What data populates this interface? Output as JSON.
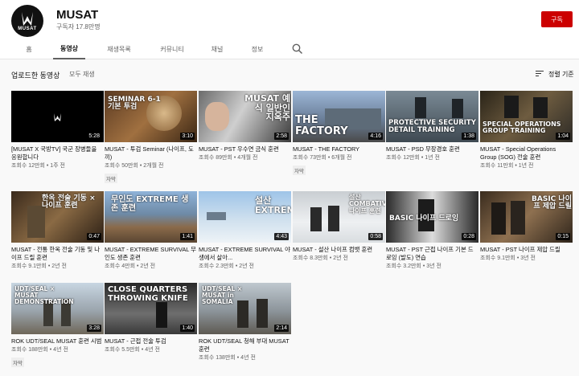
{
  "channel": {
    "name": "MUSAT",
    "subscribers": "구독자 17.8만명",
    "avatar_text": "MUSAT",
    "subscribe_label": "구독"
  },
  "tabs": [
    {
      "label": "홈",
      "active": false
    },
    {
      "label": "동영상",
      "active": true
    },
    {
      "label": "재생목록",
      "active": false
    },
    {
      "label": "커뮤니티",
      "active": false
    },
    {
      "label": "채널",
      "active": false
    },
    {
      "label": "정보",
      "active": false
    }
  ],
  "section": {
    "title": "업로드한 동영상",
    "play_all": "모두 재생",
    "sort_label": "정렬 기준"
  },
  "videos": [
    {
      "title": "[MUSAT X 국방TV] 국군 장병들을 응원합니다",
      "views": "조회수 12만회",
      "age": "1주 전",
      "duration": "5:28",
      "thumb_text": "",
      "badge": ""
    },
    {
      "title": "MUSAT - 투검 Seminar (나이프, 도끼)",
      "views": "조회수 50만회",
      "age": "2개월 전",
      "duration": "3:10",
      "thumb_text": "SEMINAR 6-1 기본 투검",
      "badge": "자막"
    },
    {
      "title": "MUSAT - PST 우수연 금식 훈련",
      "views": "조회수 89만회",
      "age": "4개월 전",
      "duration": "2:58",
      "thumb_text": "MUSAT 예식 일반인 지옥주",
      "badge": ""
    },
    {
      "title": "MUSAT - THE FACTORY",
      "views": "조회수 73만회",
      "age": "6개월 전",
      "duration": "4:16",
      "thumb_text": "THE FACTORY",
      "badge": "자막"
    },
    {
      "title": "MUSAT - PSD 무장경호 훈련",
      "views": "조회수 12만회",
      "age": "1년 전",
      "duration": "1:38",
      "thumb_text": "PROTECTIVE SECURITY DETAIL TRAINING",
      "badge": ""
    },
    {
      "title": "MUSAT - Special Operations Group (SOG) 전술 훈련",
      "views": "조회수 11만회",
      "age": "1년 전",
      "duration": "1:04",
      "thumb_text": "SPECIAL OPERATIONS GROUP TRAINING",
      "badge": ""
    },
    {
      "title": "MUSAT - 전통 한옥 전술 기동 및 나이프 드릴 훈련",
      "views": "조회수 9.1만회",
      "age": "2년 전",
      "duration": "0:47",
      "thumb_text": "한옥 전술 기동 × 나이프 훈련",
      "badge": ""
    },
    {
      "title": "MUSAT - EXTREME SURVIVAL 무인도 생존 훈련",
      "views": "조회수 4만회",
      "age": "2년 전",
      "duration": "1:41",
      "thumb_text": "무인도 EXTREME 생존 훈련",
      "badge": ""
    },
    {
      "title": "MUSAT - EXTREME SURVIVAL 야생에서 살아...",
      "views": "조회수 2.3만회",
      "age": "2년 전",
      "duration": "4:43",
      "thumb_text": "설산 EXTREME",
      "badge": ""
    },
    {
      "title": "MUSAT - 설산 나이프 컴뱃 훈련",
      "views": "조회수 8.3만회",
      "age": "2년 전",
      "duration": "0:58",
      "thumb_text": "설산 COMBATIVES 나이프 훈련",
      "badge": ""
    },
    {
      "title": "MUSAT - PST 근접 나이프 기본 드로잉 (발도) 연습",
      "views": "조회수 3.2만회",
      "age": "3년 전",
      "duration": "0:28",
      "thumb_text": "BASIC 나이프 드로잉",
      "badge": ""
    },
    {
      "title": "MUSAT - PST 나이프 제압 드릴",
      "views": "조회수 9.1만회",
      "age": "3년 전",
      "duration": "0:15",
      "thumb_text": "BASIC 나이프 제압 드릴",
      "badge": ""
    },
    {
      "title": "ROK UDT/SEAL MUSAT 훈련 시범",
      "views": "조회수 188만회",
      "age": "4년 전",
      "duration": "3:28",
      "thumb_text": "UDT/SEAL × MUSAT DEMONSTRATION",
      "badge": "자막"
    },
    {
      "title": "MUSAT - 근접 전술 투검",
      "views": "조회수 5.5만회",
      "age": "4년 전",
      "duration": "1:40",
      "thumb_text": "CLOSE QUARTERS THROWING KNIFE",
      "badge": ""
    },
    {
      "title": "ROK UDT/SEAL 청해 부대 MUSAT 훈련",
      "views": "조회수 138만회",
      "age": "4년 전",
      "duration": "2:14",
      "thumb_text": "UDT/SEAL × MUSAT in SOMALIA",
      "badge": ""
    }
  ],
  "icons": {
    "search": "search-icon",
    "sort": "sort-icon"
  },
  "colors": {
    "subscribe": "#cc0000",
    "background": "#f9f9f9"
  }
}
